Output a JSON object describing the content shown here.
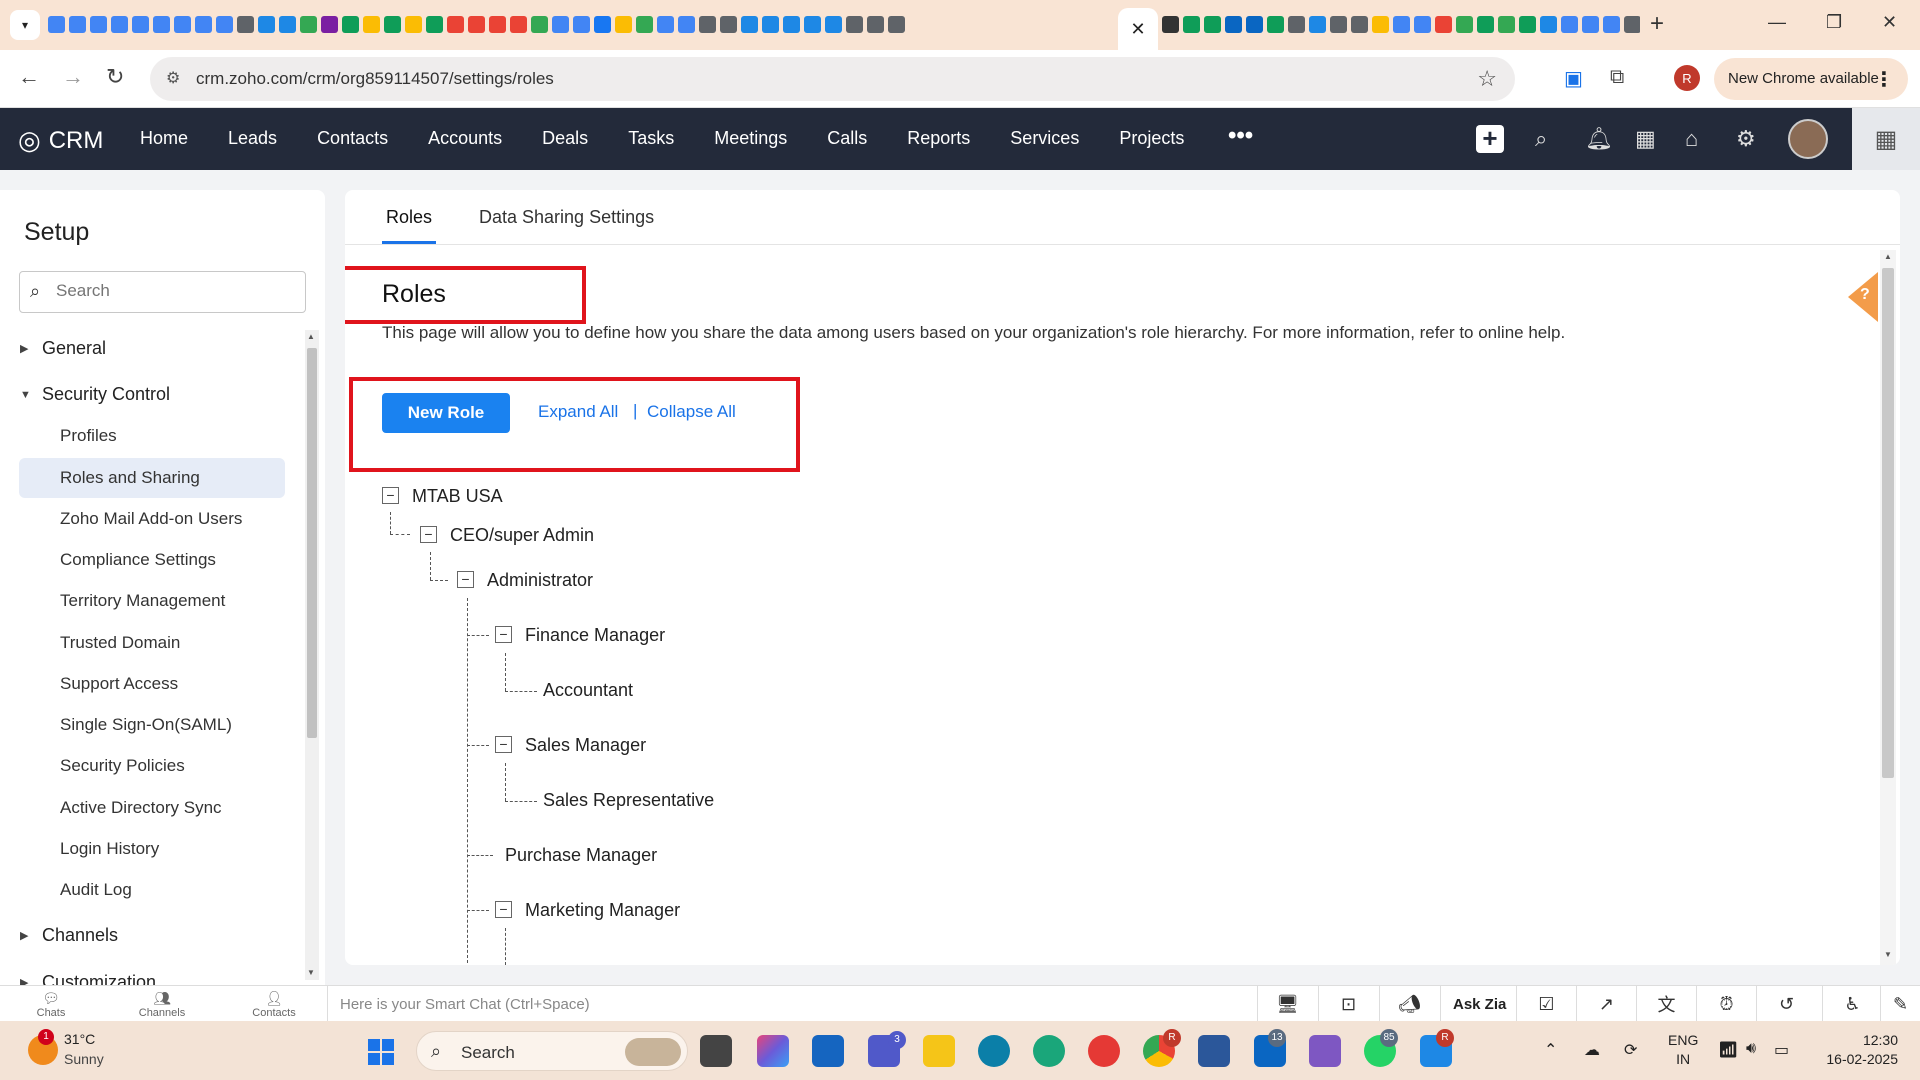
{
  "browser": {
    "url": "crm.zoho.com/crm/org859114507/settings/roles",
    "new_chrome_label": "New Chrome available",
    "profile_initial": "R",
    "favicon_colors": [
      "#4285f4",
      "#4285f4",
      "#4285f4",
      "#4285f4",
      "#4285f4",
      "#4285f4",
      "#4285f4",
      "#4285f4",
      "#4285f4",
      "#5f6368",
      "#1e88e5",
      "#1e88e5",
      "#34a853",
      "#7b1fa2",
      "#0f9d58",
      "#fbbc04",
      "#0f9d58",
      "#fbbc04",
      "#0f9d58",
      "#ea4335",
      "#ea4335",
      "#ea4335",
      "#ea4335",
      "#34a853",
      "#4285f4",
      "#4285f4",
      "#1877f2",
      "#fbbc04",
      "#34a853",
      "#4285f4",
      "#4285f4",
      "#5f6368",
      "#5f6368",
      "#1e88e5",
      "#1e88e5",
      "#1e88e5",
      "#1e88e5",
      "#1e88e5",
      "#5f6368",
      "#5f6368",
      "#5f6368"
    ],
    "favicon_colors_right": [
      "#333333",
      "#0f9d58",
      "#0f9d58",
      "#0a66c2",
      "#0a66c2",
      "#0f9d58",
      "#5f6368",
      "#1e88e5",
      "#5f6368",
      "#5f6368",
      "#fbbc04",
      "#4285f4",
      "#4285f4",
      "#ea4335",
      "#34a853",
      "#0f9d58",
      "#34a853",
      "#0f9d58",
      "#1e88e5",
      "#4285f4",
      "#4285f4",
      "#4285f4",
      "#5f6368",
      "#1e88e5",
      "#ea4335"
    ]
  },
  "crm": {
    "logo_text": "CRM",
    "nav": [
      "Home",
      "Leads",
      "Contacts",
      "Accounts",
      "Deals",
      "Tasks",
      "Meetings",
      "Calls",
      "Reports",
      "Services",
      "Projects"
    ],
    "more": "•••",
    "apps_icon": "grid-icon"
  },
  "sidebar": {
    "title": "Setup",
    "search_placeholder": "Search",
    "sections": [
      {
        "label": "General",
        "expanded": false
      },
      {
        "label": "Security Control",
        "expanded": true
      },
      {
        "label": "Channels",
        "expanded": false
      },
      {
        "label": "Customization",
        "expanded": false
      }
    ],
    "security_items": [
      "Profiles",
      "Roles and Sharing",
      "Zoho Mail Add-on Users",
      "Compliance Settings",
      "Territory Management",
      "Trusted Domain",
      "Support Access",
      "Single Sign-On(SAML)",
      "Security Policies",
      "Active Directory Sync",
      "Login History",
      "Audit Log"
    ],
    "active_item": "Roles and Sharing"
  },
  "main": {
    "tabs": [
      "Roles",
      "Data Sharing Settings"
    ],
    "active_tab": "Roles",
    "title": "Roles",
    "description": "This page will allow you to define how you share the data among users based on your organization's role hierarchy. For more information, refer to online help.",
    "new_role_label": "New Role",
    "expand_all": "Expand All",
    "separator": "|",
    "collapse_all": "Collapse All",
    "tree": [
      {
        "label": "MTAB USA"
      },
      {
        "label": "CEO/super Admin"
      },
      {
        "label": "Administrator"
      },
      {
        "label": "Finance Manager"
      },
      {
        "label": "Accountant"
      },
      {
        "label": "Sales Manager"
      },
      {
        "label": "Sales Representative"
      },
      {
        "label": "Purchase Manager"
      },
      {
        "label": "Marketing Manager"
      }
    ],
    "help_label": "?",
    "highlight_color": "#e0141c"
  },
  "bottom_bar": {
    "items": [
      "Chats",
      "Channels",
      "Contacts"
    ],
    "smart_chat_placeholder": "Here is your Smart Chat (Ctrl+Space)",
    "ask_zia": "Ask Zia"
  },
  "taskbar": {
    "weather_temp": "31°C",
    "weather_desc": "Sunny",
    "weather_badge": "1",
    "search_label": "Search",
    "teams_badge": "3",
    "linkedin_badge": "13",
    "whatsapp_badge": "85",
    "chrome_badge": "R",
    "lang_line1": "ENG",
    "lang_line2": "IN",
    "time": "12:30",
    "date": "16-02-2025"
  }
}
